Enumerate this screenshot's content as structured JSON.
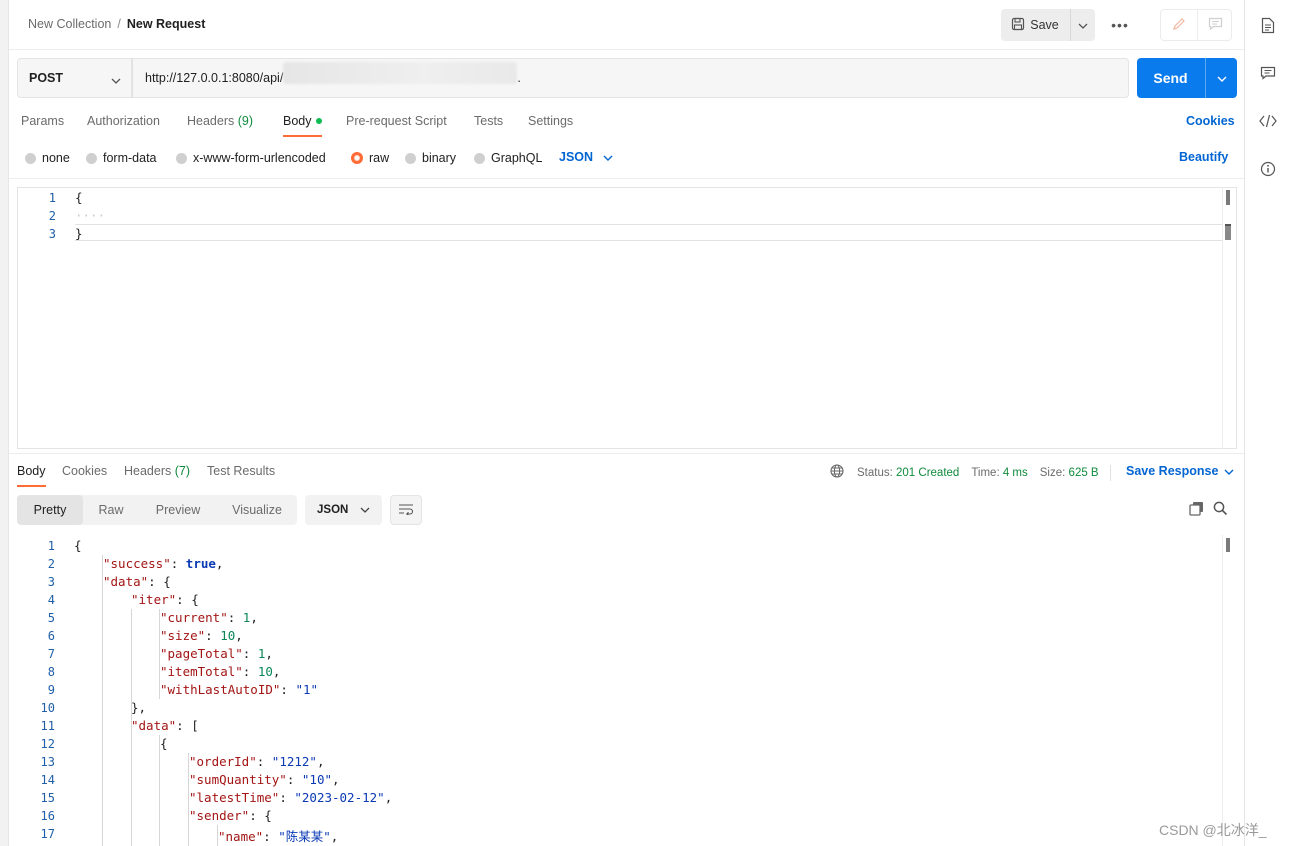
{
  "breadcrumb": {
    "collection": "New Collection",
    "separator": "/",
    "request": "New Request"
  },
  "toolbar": {
    "save_label": "Save",
    "more_label": "•••"
  },
  "request": {
    "method": "POST",
    "url": "http://127.0.0.1:8080/api/",
    "url_tail": ".",
    "send_label": "Send"
  },
  "request_tabs": [
    {
      "label": "Params"
    },
    {
      "label": "Authorization"
    },
    {
      "label": "Headers",
      "count": "(9)"
    },
    {
      "label": "Body"
    },
    {
      "label": "Pre-request Script"
    },
    {
      "label": "Tests"
    },
    {
      "label": "Settings"
    }
  ],
  "cookies_label": "Cookies",
  "body_types": [
    {
      "label": "none"
    },
    {
      "label": "form-data"
    },
    {
      "label": "x-www-form-urlencoded"
    },
    {
      "label": "raw",
      "selected": true
    },
    {
      "label": "binary"
    },
    {
      "label": "GraphQL"
    }
  ],
  "body_format": "JSON",
  "beautify_label": "Beautify",
  "request_body": {
    "line_numbers": [
      "1",
      "2",
      "3"
    ],
    "lines": [
      "{",
      "····",
      "}"
    ]
  },
  "response_tabs": [
    {
      "label": "Body"
    },
    {
      "label": "Cookies"
    },
    {
      "label": "Headers",
      "count": "(7)"
    },
    {
      "label": "Test Results"
    }
  ],
  "response_meta": {
    "status_label": "Status:",
    "status_value": "201 Created",
    "time_label": "Time:",
    "time_value": "4 ms",
    "size_label": "Size:",
    "size_value": "625 B",
    "save_response_label": "Save Response"
  },
  "view_tabs": [
    {
      "label": "Pretty"
    },
    {
      "label": "Raw"
    },
    {
      "label": "Preview"
    },
    {
      "label": "Visualize"
    }
  ],
  "response_format": "JSON",
  "response_body": {
    "line_numbers": [
      "1",
      "2",
      "3",
      "4",
      "5",
      "6",
      "7",
      "8",
      "9",
      "10",
      "11",
      "12",
      "13",
      "14",
      "15",
      "16",
      "17"
    ],
    "tokens": {
      "l1": "{",
      "l2k": "\"success\"",
      "l2v": "true",
      "l3k": "\"data\"",
      "l3v": "{",
      "l4k": "\"iter\"",
      "l4v": "{",
      "l5k": "\"current\"",
      "l5v": "1",
      "l6k": "\"size\"",
      "l6v": "10",
      "l7k": "\"pageTotal\"",
      "l7v": "1",
      "l8k": "\"itemTotal\"",
      "l8v": "10",
      "l9k": "\"withLastAutoID\"",
      "l9v": "\"1\"",
      "l10": "},",
      "l11k": "\"data\"",
      "l11v": "[",
      "l12": "{",
      "l13k": "\"orderId\"",
      "l13v": "\"1212\"",
      "l14k": "\"sumQuantity\"",
      "l14v": "\"10\"",
      "l15k": "\"latestTime\"",
      "l15v": "\"2023-02-12\"",
      "l16k": "\"sender\"",
      "l16v": "{",
      "l17k": "\"name\"",
      "l17v": "\"陈某某\""
    }
  },
  "watermark": "CSDN @北冰洋_",
  "colors": {
    "accent": "#ff6c37",
    "primary": "#097bed",
    "link": "#0265d2",
    "success": "#0f8a3c"
  }
}
